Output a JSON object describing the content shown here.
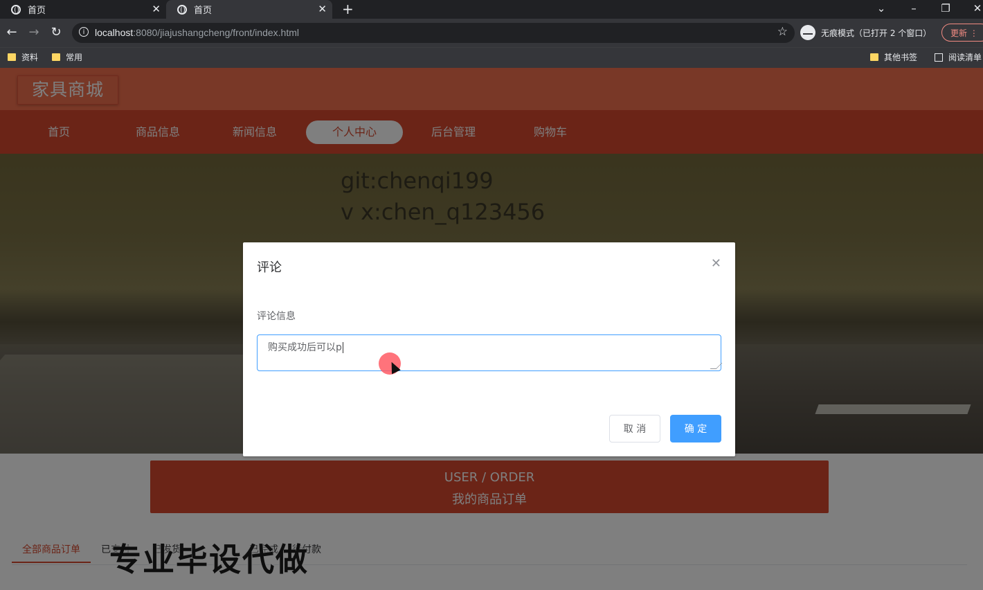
{
  "browser": {
    "tabs": [
      {
        "title": "首页",
        "active": false
      },
      {
        "title": "首页",
        "active": true
      }
    ],
    "url_host": "localhost",
    "url_rest": ":8080/jiajushangcheng/front/index.html",
    "incognito_label": "无痕模式（已打开 2 个窗口）",
    "update_label": "更新",
    "bookmarks": [
      "资料",
      "常用"
    ],
    "bookmarks_right": [
      "其他书签",
      "阅读清单"
    ]
  },
  "site": {
    "logo": "家具商城",
    "nav": [
      "首页",
      "商品信息",
      "新闻信息",
      "个人中心",
      "后台管理",
      "购物车"
    ],
    "active_nav": "个人中心",
    "banner_watermark": [
      "git:chenqi199",
      "v x:chen_q123456"
    ]
  },
  "orders": {
    "heading_en": "USER / ORDER",
    "heading_cn": "我的商品订单",
    "tabs": [
      "全部商品订单",
      "已支付",
      "已发货",
      "已完成",
      "待付款"
    ],
    "overlay_watermark": "专业毕设代做"
  },
  "dialog": {
    "title": "评论",
    "field_label": "评论信息",
    "textarea_value": "购买成功后可以p",
    "cancel_label": "取 消",
    "confirm_label": "确 定"
  },
  "colors": {
    "header": "#f3704e",
    "nav": "#d6492f",
    "primary_button": "#409eff"
  }
}
